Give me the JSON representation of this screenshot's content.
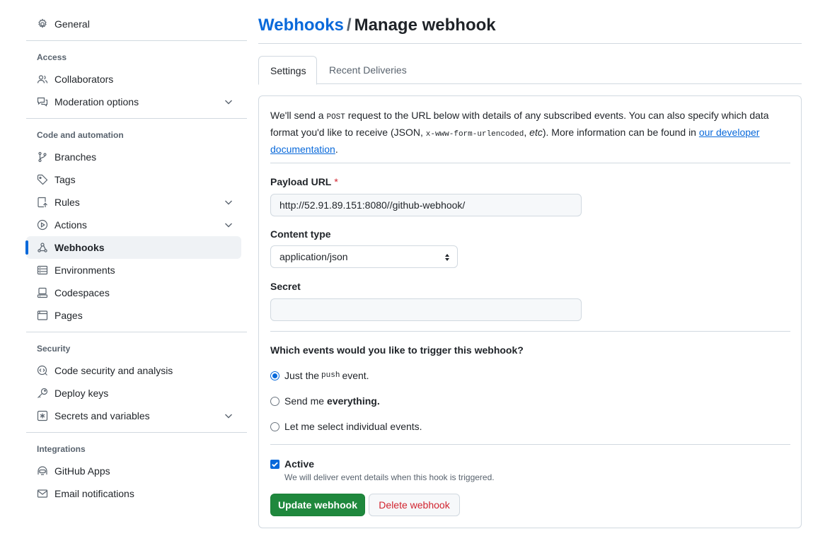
{
  "sidebar": {
    "general": {
      "label": "General",
      "icon": "gear-icon"
    },
    "sections": {
      "access": {
        "heading": "Access"
      },
      "code": {
        "heading": "Code and automation"
      },
      "security": {
        "heading": "Security"
      },
      "integrations": {
        "heading": "Integrations"
      }
    },
    "items": {
      "collaborators": {
        "label": "Collaborators",
        "icon": "people-icon"
      },
      "moderation": {
        "label": "Moderation options",
        "icon": "comment-discussion-icon"
      },
      "branches": {
        "label": "Branches",
        "icon": "git-branch-icon"
      },
      "tags": {
        "label": "Tags",
        "icon": "tag-icon"
      },
      "rules": {
        "label": "Rules",
        "icon": "repo-push-icon"
      },
      "actions": {
        "label": "Actions",
        "icon": "play-icon"
      },
      "webhooks": {
        "label": "Webhooks",
        "icon": "webhook-icon",
        "selected": true
      },
      "environments": {
        "label": "Environments",
        "icon": "server-icon"
      },
      "codespaces": {
        "label": "Codespaces",
        "icon": "codespaces-icon"
      },
      "pages": {
        "label": "Pages",
        "icon": "browser-icon"
      },
      "code_security": {
        "label": "Code security and analysis",
        "icon": "codescan-icon"
      },
      "deploy_keys": {
        "label": "Deploy keys",
        "icon": "key-icon"
      },
      "secrets": {
        "label": "Secrets and variables",
        "icon": "key-asterisk-icon"
      },
      "github_apps": {
        "label": "GitHub Apps",
        "icon": "hubot-icon"
      },
      "email": {
        "label": "Email notifications",
        "icon": "mail-icon"
      }
    }
  },
  "header": {
    "breadcrumb_link": "Webhooks",
    "separator": "/",
    "title": "Manage webhook"
  },
  "tabs": {
    "settings": "Settings",
    "deliveries": "Recent Deliveries"
  },
  "intro": {
    "part1": "We'll send a ",
    "post_code": "POST",
    "part2": " request to the URL below with details of any subscribed events. You can also specify which data format you'd like to receive (JSON, ",
    "urlencoded_code": "x-www-form-urlencoded",
    "part3": ", ",
    "etc": "etc",
    "part4": "). More information can be found in ",
    "link_text": "our developer documentation",
    "part5": "."
  },
  "form": {
    "payload_label": "Payload URL",
    "required_mark": "*",
    "payload_value": "http://52.91.89.151:8080//github-webhook/",
    "content_type_label": "Content type",
    "content_type_value": "application/json",
    "secret_label": "Secret",
    "secret_value": "",
    "events_question": "Which events would you like to trigger this webhook?",
    "event_options": {
      "push_prefix": "Just the",
      "push_code": "push",
      "push_suffix": "event.",
      "everything_prefix": "Send me",
      "everything_bold": "everything.",
      "individual": "Let me select individual events."
    },
    "selected_event": "push",
    "active_label": "Active",
    "active_checked": true,
    "active_help": "We will deliver event details when this hook is triggered.",
    "update_button": "Update webhook",
    "delete_button": "Delete webhook"
  },
  "colors": {
    "accent": "#0969da",
    "primary_button": "#1f883d",
    "danger": "#d1242f"
  }
}
